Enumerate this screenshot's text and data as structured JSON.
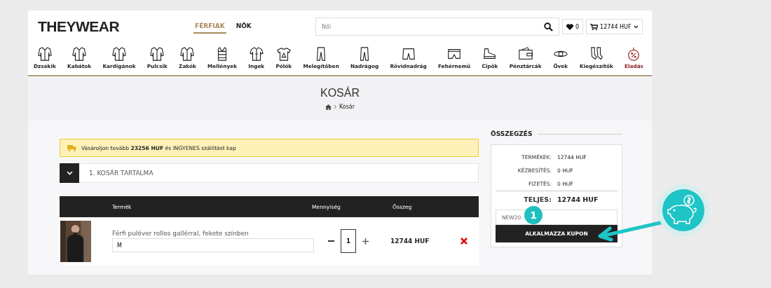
{
  "header": {
    "logo": "THEYWEAR",
    "gender_tabs": [
      {
        "label": "FÉRFIAK",
        "selected": true
      },
      {
        "label": "NŐK",
        "selected": false
      }
    ],
    "search": {
      "placeholder": "Női"
    },
    "wishlist": {
      "count": "0"
    },
    "cart": {
      "total": "12744 HUF"
    }
  },
  "categories": [
    {
      "label": "Dzsekik",
      "sale": false
    },
    {
      "label": "Kabátok",
      "sale": false
    },
    {
      "label": "Kardigánok",
      "sale": false
    },
    {
      "label": "Pulcsik",
      "sale": false
    },
    {
      "label": "Zakók",
      "sale": false
    },
    {
      "label": "Mellények",
      "sale": false
    },
    {
      "label": "Ingek",
      "sale": false
    },
    {
      "label": "Pólók",
      "sale": false
    },
    {
      "label": "Melegítőben",
      "sale": false
    },
    {
      "label": "Nadrágog",
      "sale": false
    },
    {
      "label": "Rövidnadrág",
      "sale": false
    },
    {
      "label": "Fehérnemű",
      "sale": false
    },
    {
      "label": "Cipők",
      "sale": false
    },
    {
      "label": "Pénztárcák",
      "sale": false
    },
    {
      "label": "Övek",
      "sale": false
    },
    {
      "label": "Kiegészítők",
      "sale": false
    },
    {
      "label": "Eladás",
      "sale": true
    }
  ],
  "page_title": "KOSÁR",
  "breadcrumb": [
    "Kosár"
  ],
  "shipping_notice": "Vásároljon tovább **23256 HUF** és INGYENES szállítást kap",
  "section": {
    "title": "1. KOSÁR TARTALMA",
    "expanded": true
  },
  "table": {
    "columns": [
      "Termék",
      "Mennyiség",
      "Összeg"
    ],
    "rows": [
      {
        "name": "Férfi pulóver rollos gallérral, fekete színben",
        "size": "M",
        "quantity": "1",
        "sum": "12744 HUF"
      }
    ]
  },
  "summary": {
    "title": "ÖSSZEGZÉS",
    "lines": [
      {
        "label": "TERMÉKEK:",
        "value": "12744 HUF"
      },
      {
        "label": "KÉZBESÍTÉS:",
        "value": "0 HUF"
      },
      {
        "label": "FIZETÉS:",
        "value": "0 HUF"
      }
    ],
    "total": {
      "label": "TELJES:",
      "value": "12744 HUF"
    },
    "coupon": {
      "value": "NEW20"
    },
    "apply_button": "ALKALMAZZA KUPON"
  },
  "callout": {
    "step": "1"
  }
}
